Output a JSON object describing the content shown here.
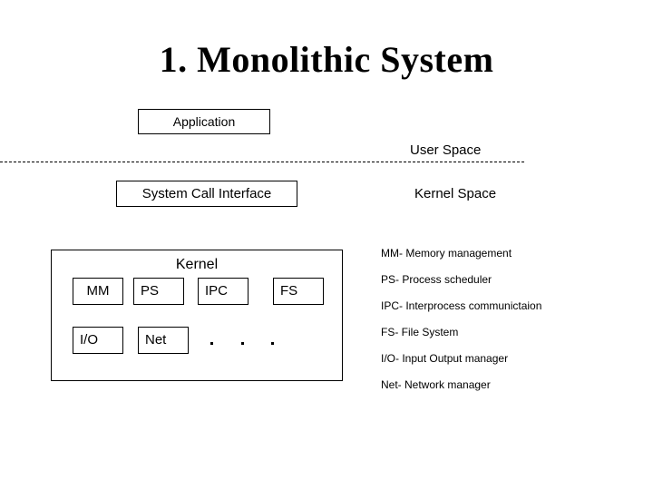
{
  "slide": {
    "title": "1. Monolithic System",
    "background_color": "#ffffff",
    "text_color": "#000000"
  },
  "diagram": {
    "application_box": {
      "label": "Application"
    },
    "system_call_interface_box": {
      "label": "System Call Interface"
    },
    "user_space_label": "User Space",
    "kernel_space_label": "Kernel Space",
    "kernel": {
      "title": "Kernel",
      "modules_row1": [
        {
          "label": "MM"
        },
        {
          "label": "PS"
        },
        {
          "label": "IPC"
        },
        {
          "label": "FS"
        }
      ],
      "modules_row2": [
        {
          "label": "I/O"
        },
        {
          "label": "Net"
        }
      ],
      "ellipsis_dot_count": 3
    }
  },
  "legend": {
    "items": [
      {
        "text": "MM- Memory management"
      },
      {
        "text": "PS- Process scheduler"
      },
      {
        "text": "IPC- Interprocess communictaion"
      },
      {
        "text": "FS- File System"
      },
      {
        "text": "I/O- Input Output manager"
      },
      {
        "text": "Net- Network manager"
      }
    ]
  }
}
